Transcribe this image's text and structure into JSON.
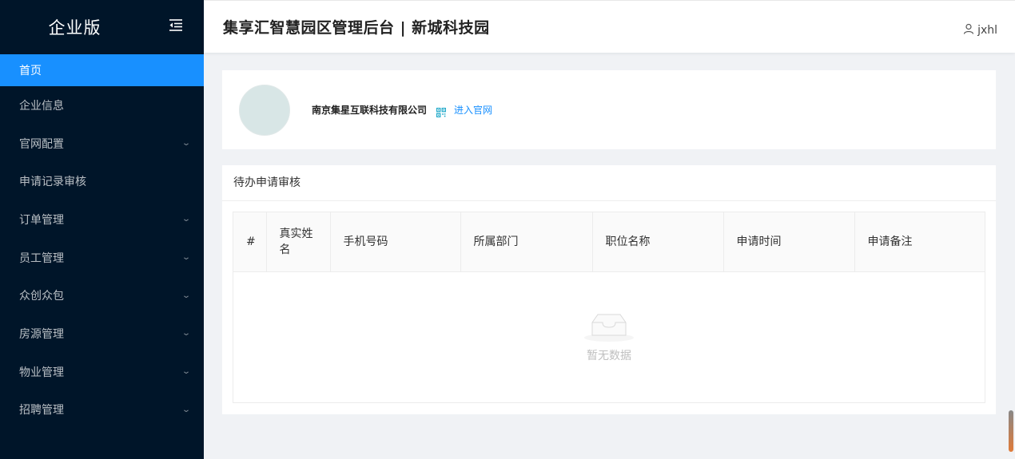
{
  "brand": {
    "title": "企业版"
  },
  "header": {
    "title": "集享汇智慧园区管理后台 | 新城科技园",
    "user": "jxhl"
  },
  "menu": {
    "items": [
      {
        "label": "首页",
        "active": true,
        "has_sub": false
      },
      {
        "label": "企业信息",
        "active": false,
        "has_sub": false
      },
      {
        "label": "官网配置",
        "active": false,
        "has_sub": true
      },
      {
        "label": "申请记录审核",
        "active": false,
        "has_sub": false
      },
      {
        "label": "订单管理",
        "active": false,
        "has_sub": true
      },
      {
        "label": "员工管理",
        "active": false,
        "has_sub": true
      },
      {
        "label": "众创众包",
        "active": false,
        "has_sub": true
      },
      {
        "label": "房源管理",
        "active": false,
        "has_sub": true
      },
      {
        "label": "物业管理",
        "active": false,
        "has_sub": true
      },
      {
        "label": "招聘管理",
        "active": false,
        "has_sub": true
      }
    ]
  },
  "company": {
    "name": "南京集星互联科技有限公司",
    "link": "进入官网"
  },
  "pending": {
    "title": "待办申请审核",
    "columns": [
      "#",
      "真实姓名",
      "手机号码",
      "所属部门",
      "职位名称",
      "申请时间",
      "申请备注"
    ],
    "empty_text": "暂无数据"
  },
  "colors": {
    "sidebar": "#001529",
    "active": "#1890ff",
    "link": "#1890ff"
  }
}
